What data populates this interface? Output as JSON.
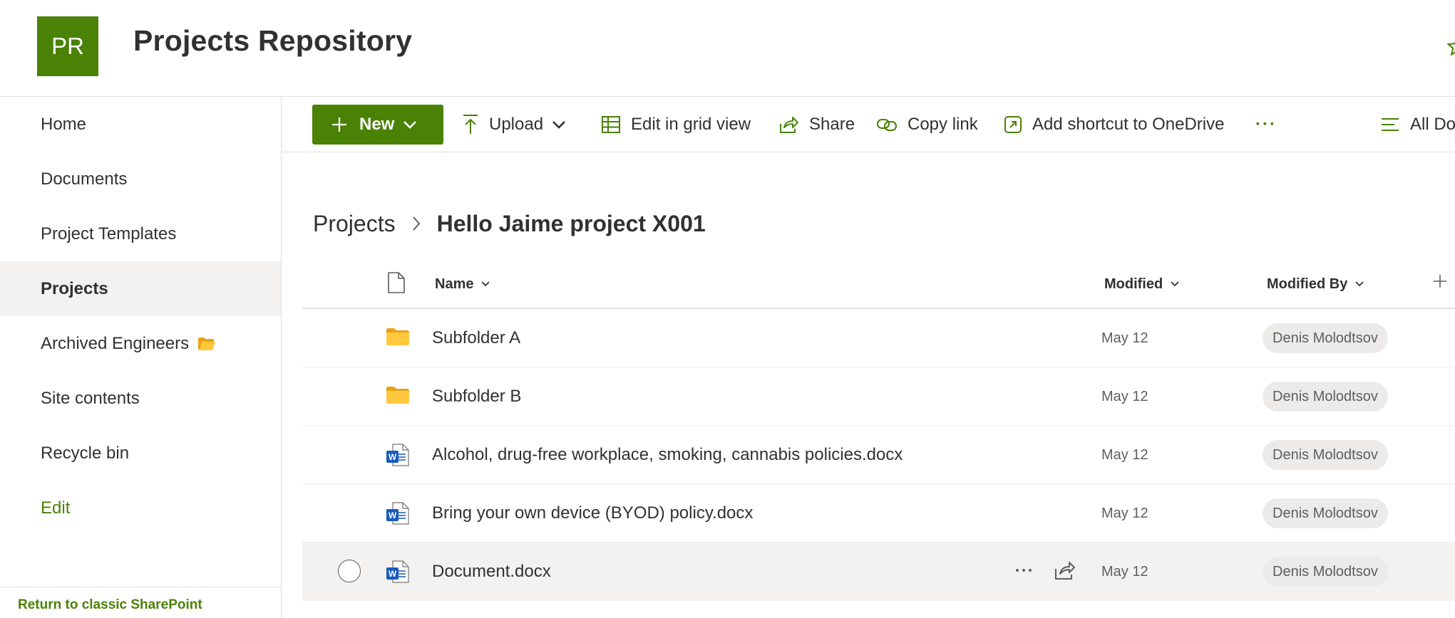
{
  "header": {
    "logo_initials": "PR",
    "title": "Projects Repository",
    "brand_color": "#498205"
  },
  "nav": {
    "items": [
      {
        "label": "Home"
      },
      {
        "label": "Documents"
      },
      {
        "label": "Project Templates"
      },
      {
        "label": "Projects",
        "selected": true
      },
      {
        "label": "Archived Engineers",
        "icon": "folder-emoji-icon"
      },
      {
        "label": "Site contents"
      },
      {
        "label": "Recycle bin"
      }
    ],
    "edit_label": "Edit",
    "footer_link": "Return to classic SharePoint"
  },
  "toolbar": {
    "new_label": "New",
    "upload_label": "Upload",
    "grid_label": "Edit in grid view",
    "share_label": "Share",
    "copy_link_label": "Copy link",
    "shortcut_label": "Add shortcut to OneDrive",
    "more_label": "···",
    "view_label": "All Do"
  },
  "breadcrumb": {
    "parent": "Projects",
    "current": "Hello Jaime project X001"
  },
  "list": {
    "columns": {
      "name": "Name",
      "modified": "Modified",
      "modified_by": "Modified By"
    },
    "rows": [
      {
        "type": "folder",
        "name": "Subfolder A",
        "modified": "May 12",
        "modified_by": "Denis Molodtsov"
      },
      {
        "type": "folder",
        "name": "Subfolder B",
        "modified": "May 12",
        "modified_by": "Denis Molodtsov"
      },
      {
        "type": "word",
        "name": "Alcohol, drug-free workplace, smoking, cannabis policies.docx",
        "modified": "May 12",
        "modified_by": "Denis Molodtsov"
      },
      {
        "type": "word",
        "name": "Bring your own device (BYOD) policy.docx",
        "modified": "May 12",
        "modified_by": "Denis Molodtsov"
      },
      {
        "type": "word",
        "name": "Document.docx",
        "modified": "May 12",
        "modified_by": "Denis Molodtsov",
        "hovered": true
      }
    ]
  },
  "icons": {
    "folder_color": "#ffb900",
    "word_color": "#185abd"
  }
}
